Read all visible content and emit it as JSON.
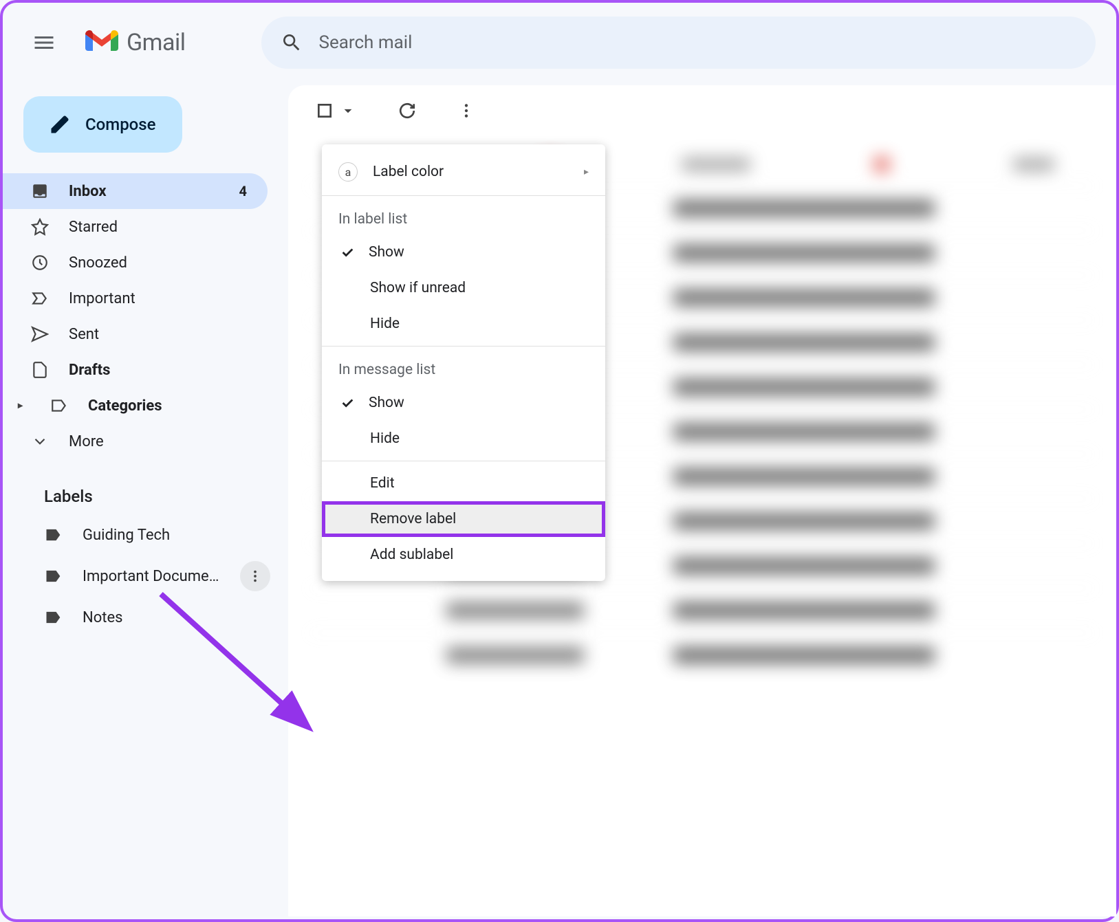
{
  "header": {
    "logo_text": "Gmail",
    "search_placeholder": "Search mail"
  },
  "compose_label": "Compose",
  "nav": {
    "inbox": "Inbox",
    "inbox_count": "4",
    "starred": "Starred",
    "snoozed": "Snoozed",
    "important": "Important",
    "sent": "Sent",
    "drafts": "Drafts",
    "categories": "Categories",
    "more": "More"
  },
  "labels_header": "Labels",
  "labels": {
    "0": "Guiding Tech",
    "1": "Important Docume...",
    "2": "Notes"
  },
  "menu": {
    "label_color": "Label color",
    "section_label_list": "In label list",
    "show": "Show",
    "show_if_unread": "Show if unread",
    "hide": "Hide",
    "section_message_list": "In message list",
    "show2": "Show",
    "hide2": "Hide",
    "edit": "Edit",
    "remove_label": "Remove label",
    "add_sublabel": "Add sublabel"
  }
}
